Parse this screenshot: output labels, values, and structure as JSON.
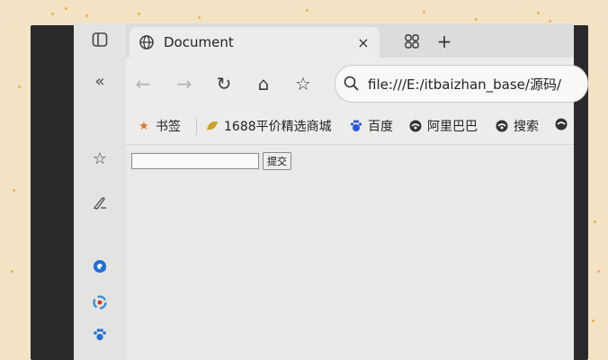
{
  "tab": {
    "title": "Document",
    "close_glyph": "×"
  },
  "tabstrip": {
    "new_tab_glyph": "+",
    "tab_actions_icon": "tab-actions-icon"
  },
  "toolbar": {
    "back_glyph": "←",
    "forward_glyph": "→",
    "refresh_glyph": "↻",
    "home_glyph": "⌂",
    "favorite_glyph": "☆",
    "address_url": "file:///E:/itbaizhan_base/源码/"
  },
  "favorites": [
    {
      "label": "书签",
      "icon": "star-icon",
      "color": "#e0762a"
    },
    {
      "label": "1688平价精选商城",
      "icon": "1688-icon",
      "color": "#c9a227"
    },
    {
      "label": "百度",
      "icon": "baidu-icon",
      "color": "#2b55d9"
    },
    {
      "label": "阿里巴巴",
      "icon": "alibaba-icon",
      "color": "#333333"
    },
    {
      "label": "搜索",
      "icon": "search-engine-icon",
      "color": "#333333"
    }
  ],
  "sidebar": {
    "collapse_glyph": "«",
    "favorites_glyph": "☆",
    "icons": [
      "panel-icon",
      "collapse-icon",
      "favorites-icon",
      "pen-icon",
      "q-app-icon",
      "circle-app-icon",
      "paw-app-icon"
    ]
  },
  "form": {
    "input_value": "",
    "submit_label": "提交"
  },
  "colors": {
    "accent_blue": "#1f6fd6",
    "screen_bg": "#e9e9e8"
  }
}
